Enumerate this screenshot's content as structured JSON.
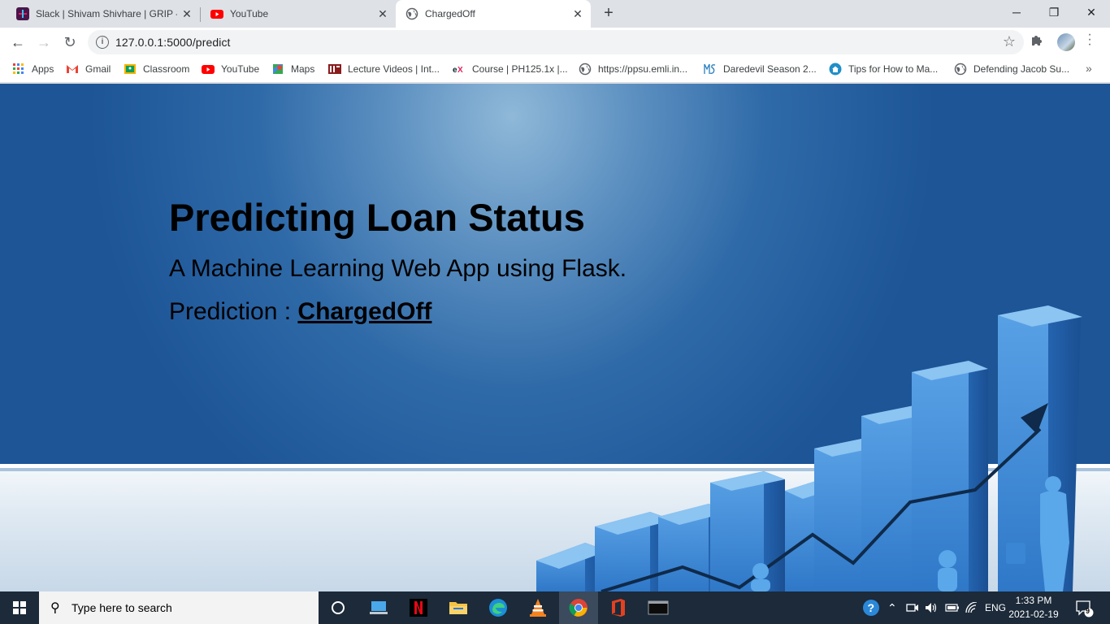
{
  "browser": {
    "tabs": [
      {
        "title": "Slack | Shivam Shivhare | GRIP - F",
        "active": false
      },
      {
        "title": "YouTube",
        "active": false
      },
      {
        "title": "ChargedOff",
        "active": true
      }
    ],
    "new_tab_label": "+",
    "window_controls": {
      "minimize": "─",
      "restore": "❐",
      "close": "✕"
    },
    "url": "127.0.0.1:5000/predict",
    "bookmarks": [
      {
        "label": "Apps",
        "icon": "apps-grid-icon"
      },
      {
        "label": "Gmail",
        "icon": "gmail-icon"
      },
      {
        "label": "Classroom",
        "icon": "classroom-icon"
      },
      {
        "label": "YouTube",
        "icon": "youtube-icon"
      },
      {
        "label": "Maps",
        "icon": "maps-icon"
      },
      {
        "label": "Lecture Videos | Int...",
        "icon": "mit-ocw-icon"
      },
      {
        "label": "Course | PH125.1x |...",
        "icon": "edx-icon"
      },
      {
        "label": "https://ppsu.emli.in...",
        "icon": "globe-icon"
      },
      {
        "label": "Daredevil Season 2...",
        "icon": "ms-icon"
      },
      {
        "label": "Tips for How to Ma...",
        "icon": "home-circle-icon"
      },
      {
        "label": "Defending Jacob Su...",
        "icon": "globe-icon"
      }
    ],
    "bookmarks_overflow": "»"
  },
  "page": {
    "title": "Predicting Loan Status",
    "subtitle": "A Machine Learning Web App using Flask.",
    "prediction_label": "Prediction : ",
    "prediction_value": "ChargedOff"
  },
  "taskbar": {
    "search_placeholder": "Type here to search",
    "apps": [
      "task-view-icon",
      "file-explorer-pc-icon",
      "netflix-icon",
      "folder-icon",
      "edge-icon",
      "vlc-icon",
      "chrome-icon",
      "office-icon",
      "terminal-icon"
    ],
    "language": "ENG",
    "time": "1:33 PM",
    "date": "2021-02-19",
    "notification_count": "9"
  },
  "colors": {
    "hero_dark": "#1d5597",
    "hero_light": "#8fb8d8",
    "taskbar": "#1c2a3a"
  }
}
